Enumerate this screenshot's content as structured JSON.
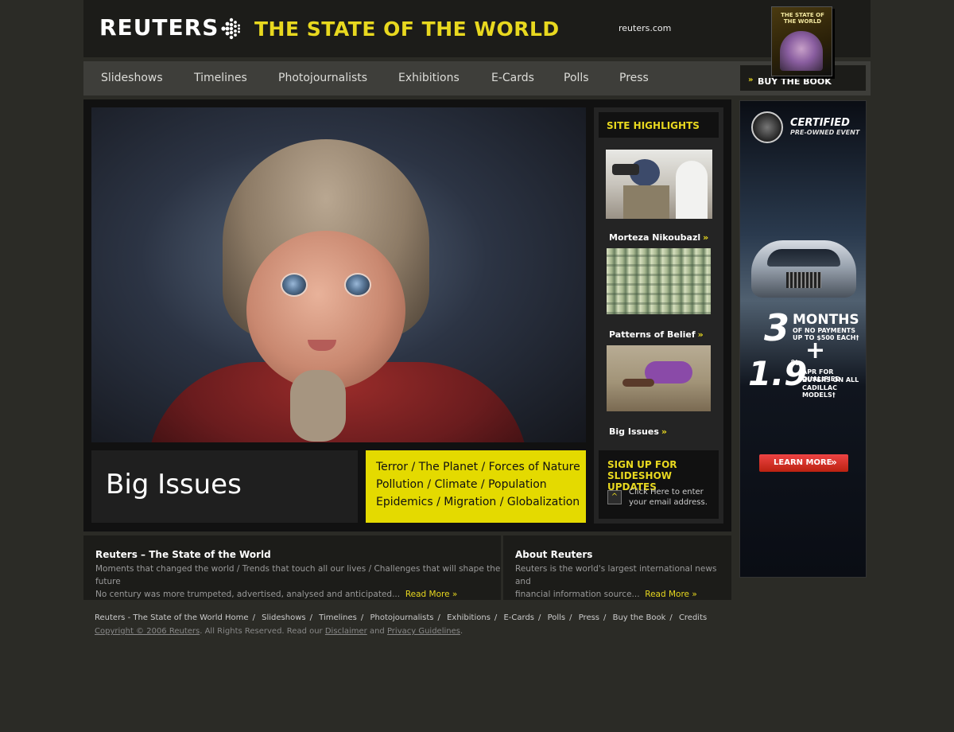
{
  "header": {
    "logo_text": "REUTERS",
    "title": "THE STATE OF THE WORLD",
    "site_link": "reuters.com",
    "book_cover_title": "THE STATE OF THE WORLD"
  },
  "nav": {
    "items": [
      "Slideshows",
      "Timelines",
      "Photojournalists",
      "Exhibitions",
      "E-Cards",
      "Polls",
      "Press"
    ],
    "buy_book": "BUY THE BOOK"
  },
  "main": {
    "big_issues_title": "Big Issues",
    "topics": [
      "Terror / The Planet / Forces of Nature",
      "Pollution / Climate / Population",
      "Epidemics / Migration / Globalization"
    ]
  },
  "highlights": {
    "header": "SITE HIGHLIGHTS",
    "items": [
      {
        "label": "Morteza Nikoubazl"
      },
      {
        "label": "Patterns of Belief"
      },
      {
        "label": "Big Issues"
      }
    ],
    "arrow": "»",
    "signup_title_1": "SIGN UP FOR",
    "signup_title_2": "SLIDESHOW UPDATES",
    "signup_text_1": "Click Here to enter",
    "signup_text_2": "your email address."
  },
  "ad": {
    "brand_line1": "CERTIFIED",
    "brand_line2": "PRE-OWNED EVENT",
    "offer_big1": "3",
    "offer_line1": "MONTHS",
    "offer_line2": "OF NO PAYMENTS",
    "offer_line3": "UP TO $500 EACH†",
    "plus": "+",
    "offer_big2": "1.9",
    "percent": "%",
    "apr_line1": "APR FOR QUALIFIED",
    "apr_line2": "BUYERS ON ALL",
    "apr_line3": "CADILLAC MODELS†",
    "cta": "LEARN MORE"
  },
  "info": {
    "left_title": "Reuters – The State of the World",
    "left_line1": "Moments that changed the world / Trends that touch all our lives / Challenges that will shape the future",
    "left_line2": "No century was more trumpeted, advertised, analysed and anticipated...",
    "right_title": "About Reuters",
    "right_line1": "Reuters is the world's largest international news and",
    "right_line2": "financial information source...",
    "read_more": "Read More"
  },
  "footer": {
    "links": [
      "Reuters - The State of the World Home",
      "Slideshows",
      "Timelines",
      "Photojournalists",
      "Exhibitions",
      "E-Cards",
      "Polls",
      "Press",
      "Buy the Book",
      "Credits"
    ],
    "copyright": "Copyright © 2006 Reuters",
    "rights_text": ". All Rights Reserved. Read our",
    "disclaimer": "Disclaimer",
    "and": "and",
    "privacy": "Privacy Guidelines",
    "period": "."
  },
  "colors": {
    "accent_yellow": "#e4da00",
    "background": "#2b2b26"
  }
}
